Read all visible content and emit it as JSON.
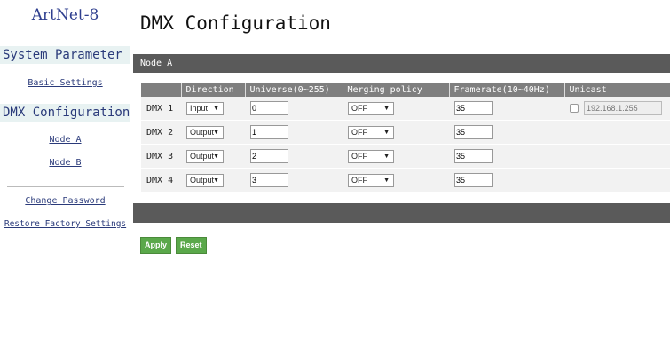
{
  "sidebar": {
    "brand": "ArtNet-8",
    "system_parameter": "System Parameter",
    "basic_settings": "Basic Settings",
    "dmx_configuration": "DMX Configuration",
    "node_a": "Node A",
    "node_b": "Node B",
    "change_password": "Change Password",
    "restore_factory": "Restore Factory Settings"
  },
  "page": {
    "title": "DMX Configuration",
    "node_bar": "Node A"
  },
  "table": {
    "headers": [
      "",
      "Direction",
      "Universe(0~255)",
      "Merging policy",
      "Framerate(10~40Hz)",
      "Unicast"
    ],
    "rows": [
      {
        "label": "DMX 1",
        "direction": "Input",
        "universe": "0",
        "merging": "OFF",
        "framerate": "35",
        "unicast_ip": "192.168.1.255"
      },
      {
        "label": "DMX 2",
        "direction": "Output",
        "universe": "1",
        "merging": "OFF",
        "framerate": "35"
      },
      {
        "label": "DMX 3",
        "direction": "Output",
        "universe": "2",
        "merging": "OFF",
        "framerate": "35"
      },
      {
        "label": "DMX 4",
        "direction": "Output",
        "universe": "3",
        "merging": "OFF",
        "framerate": "35"
      }
    ]
  },
  "buttons": {
    "apply": "Apply",
    "reset": "Reset"
  },
  "colors": {
    "accent_green": "#5aa84a",
    "header_bar": "#5a5a5a",
    "nav_text": "#2a3a7a"
  }
}
